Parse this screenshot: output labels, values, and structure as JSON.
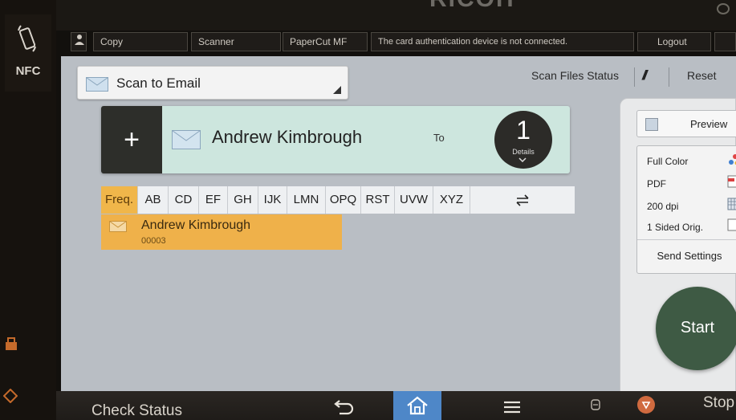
{
  "header": {
    "brand": "RICOH",
    "buttons": {
      "copy": "Copy",
      "scanner": "Scanner",
      "papercut": "PaperCut MF",
      "status_message": "The card authentication device is not connected.",
      "logout": "Logout"
    }
  },
  "left_bar": {
    "nfc_label": "NFC"
  },
  "main": {
    "mode_dropdown": "Scan to Email",
    "scan_files_status": "Scan Files Status",
    "reset": "Reset",
    "destination": {
      "add": "+",
      "name": "Andrew Kimbrough",
      "field": "To",
      "count": "1",
      "details": "Details"
    },
    "tabs": [
      "Freq.",
      "AB",
      "CD",
      "EF",
      "GH",
      "IJK",
      "LMN",
      "OPQ",
      "RST",
      "UVW",
      "XYZ"
    ],
    "active_tab": "Freq.",
    "entries": [
      {
        "name": "Andrew Kimbrough",
        "number": "00003"
      }
    ]
  },
  "right_panel": {
    "preview": "Preview",
    "settings": [
      "Full Color",
      "PDF",
      "200 dpi",
      "1 Sided Orig."
    ],
    "send_settings": "Send Settings",
    "start": "Start"
  },
  "bottom_bar": {
    "check_status": "Check Status",
    "stop": "Stop"
  },
  "colors": {
    "accent_orange": "#efb14a",
    "destination_bg": "#cde6de",
    "home_blue": "#4e87c8",
    "start_green": "#3e5a44"
  }
}
